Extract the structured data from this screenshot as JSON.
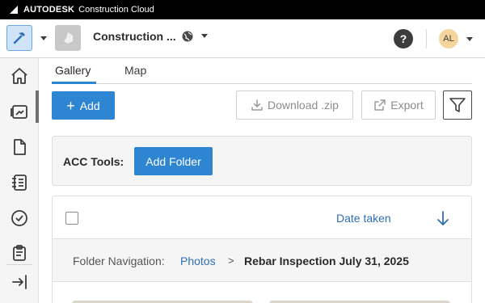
{
  "brandbar": {
    "brand": "AUTODESK",
    "product": "Construction Cloud"
  },
  "header": {
    "project_name": "Construction ...",
    "help_label": "?",
    "user_initials": "AL"
  },
  "leftnav": {
    "items": [
      "home-icon",
      "photos-icon",
      "document-icon",
      "forms-icon",
      "checkmark-icon",
      "clipboard-icon"
    ],
    "collapse": "collapse-icon"
  },
  "tabs": [
    "Gallery",
    "Map"
  ],
  "actions": {
    "add_label": "Add",
    "download_label": "Download .zip",
    "export_label": "Export"
  },
  "acc_tools": {
    "label": "ACC Tools:",
    "add_folder_label": "Add Folder"
  },
  "gallery": {
    "sort_label": "Date taken",
    "folder_nav_label": "Folder Navigation:",
    "folder_root": "Photos",
    "separator": ">",
    "current_folder": "Rebar Inspection July 31, 2025"
  },
  "colors": {
    "primary": "#2e85d2",
    "link": "#2e6fb5",
    "brandbar": "#000000",
    "avatar": "#f6d59c"
  }
}
